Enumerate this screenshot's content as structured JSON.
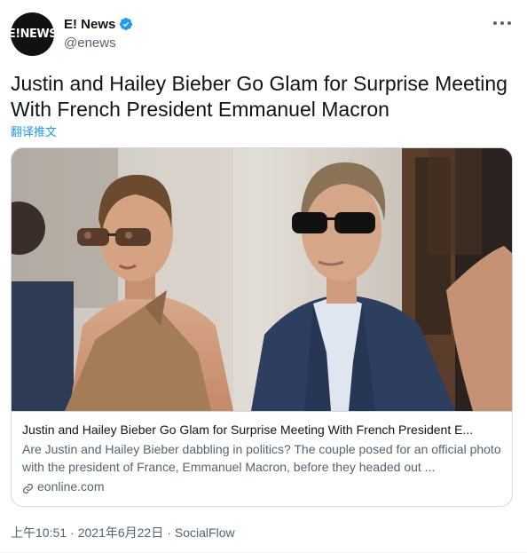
{
  "author": {
    "avatar_text": "E!NEWS",
    "display_name": "E! News",
    "handle": "@enews",
    "verified": true
  },
  "tweet": {
    "text": "Justin and Hailey Bieber Go Glam for Surprise Meeting With French President Emmanuel Macron",
    "translate_label": "翻译推文"
  },
  "card": {
    "title": "Justin and Hailey Bieber Go Glam for Surprise Meeting With French President E...",
    "description": "Are Justin and Hailey Bieber dabbling in politics? The couple posed for an official photo with the president of France, Emmanuel Macron, before they headed out ...",
    "domain": "eonline.com",
    "image_alt": "Photo of Justin and Hailey Bieber in Paris"
  },
  "meta": {
    "time": "上午10:51",
    "date": "2021年6月22日",
    "source": "SocialFlow",
    "separator": "·"
  },
  "icons": {
    "verified": "verified-badge-icon",
    "more": "more-options-icon",
    "link": "link-icon"
  },
  "colors": {
    "accent": "#1d9bf0",
    "text_primary": "#0f1419",
    "text_secondary": "#536471",
    "border": "#cfd9de"
  }
}
